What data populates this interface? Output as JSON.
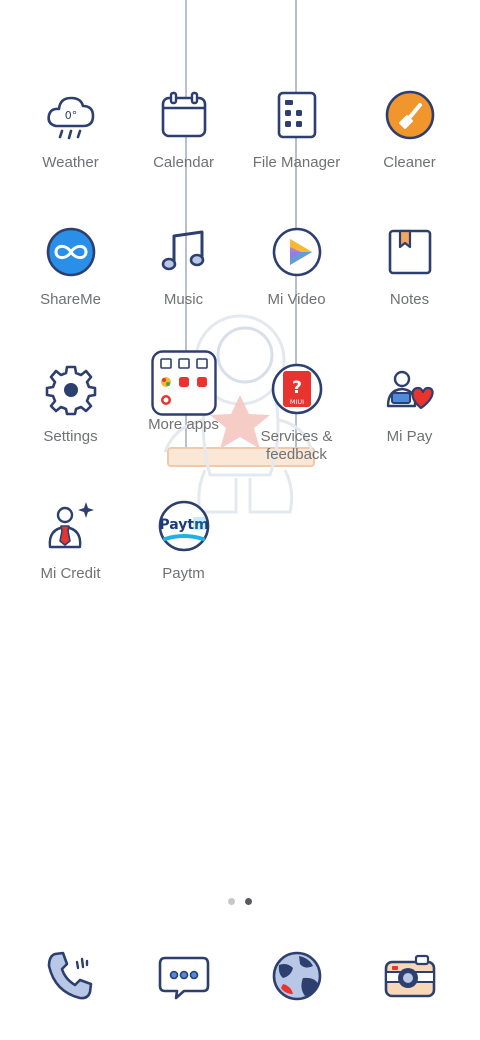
{
  "home": {
    "apps": [
      {
        "label": "Weather",
        "icon": "weather-cloud-icon",
        "temp": "0°"
      },
      {
        "label": "Calendar",
        "icon": "calendar-icon"
      },
      {
        "label": "File Manager",
        "icon": "file-manager-icon"
      },
      {
        "label": "Cleaner",
        "icon": "broom-icon"
      },
      {
        "label": "ShareMe",
        "icon": "infinity-icon"
      },
      {
        "label": "Music",
        "icon": "music-note-icon"
      },
      {
        "label": "Mi Video",
        "icon": "play-icon"
      },
      {
        "label": "Notes",
        "icon": "notes-icon"
      },
      {
        "label": "Settings",
        "icon": "gear-icon"
      },
      {
        "label": "More apps",
        "icon": "folder-icon"
      },
      {
        "label": "Services & feedback",
        "icon": "question-icon",
        "badge": "MIUI"
      },
      {
        "label": "Mi Pay",
        "icon": "mi-pay-icon"
      },
      {
        "label": "Mi Credit",
        "icon": "mi-credit-icon"
      },
      {
        "label": "Paytm",
        "icon": "paytm-icon",
        "logo_text": "Paytm"
      }
    ]
  },
  "pager": {
    "pages": 2,
    "current_page": 2
  },
  "dock": [
    {
      "icon": "phone-icon"
    },
    {
      "icon": "message-icon"
    },
    {
      "icon": "browser-globe-icon"
    },
    {
      "icon": "camera-icon"
    }
  ],
  "colors": {
    "stroke": "#2d3f6e",
    "label": "#6f7173",
    "cleaner_orange": "#f0962c",
    "shareme_blue": "#2a8fe8",
    "red": "#e8332e"
  }
}
